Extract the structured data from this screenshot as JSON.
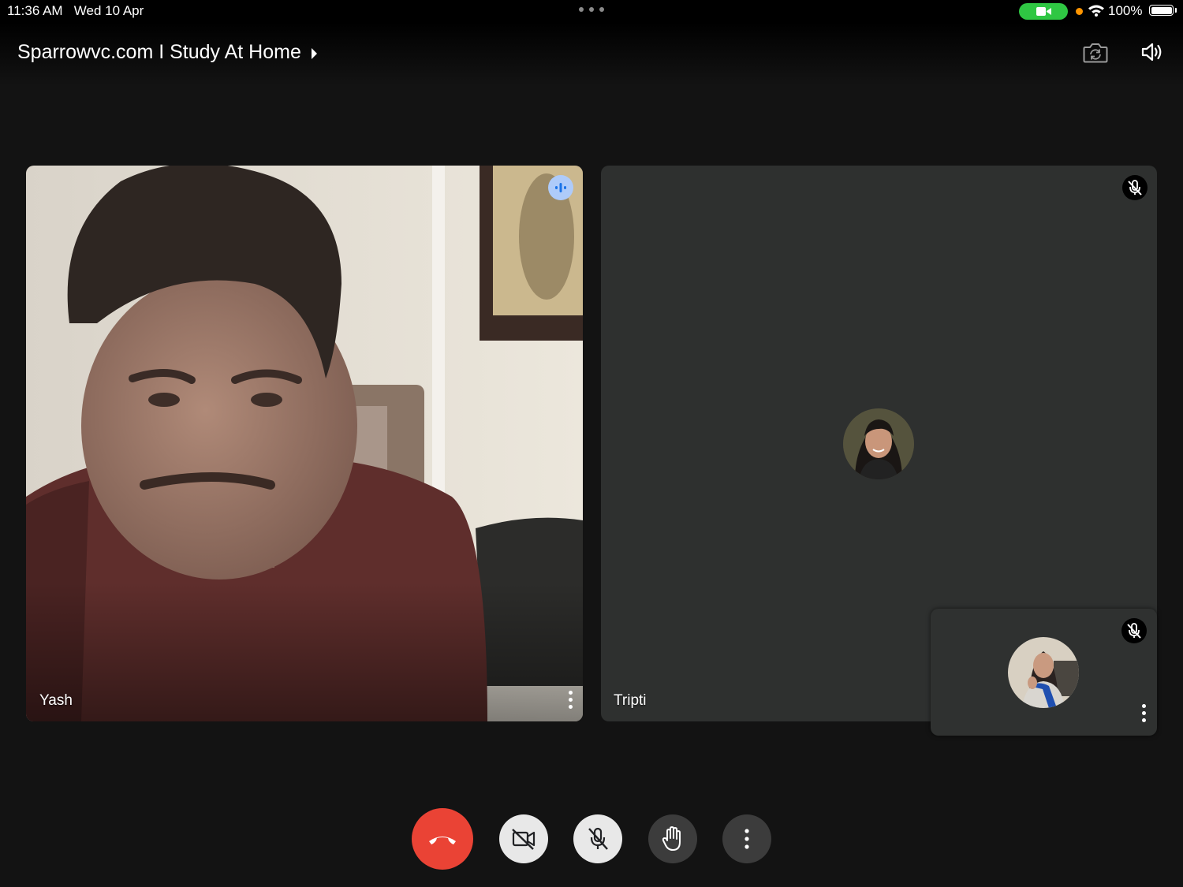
{
  "status_bar": {
    "time": "11:36 AM",
    "date": "Wed 10 Apr",
    "battery": "100%"
  },
  "meeting": {
    "title": "Sparrowvc.com I Study At Home"
  },
  "participants": [
    {
      "name": "Yash",
      "speaking": true
    },
    {
      "name": "Tripti",
      "muted": true
    }
  ],
  "self_view": {
    "muted": true
  },
  "controls": [
    "end-call",
    "camera-off",
    "mic-off",
    "raise-hand",
    "more-options"
  ],
  "colors": {
    "end_call": "#ea4335",
    "speaking_badge": "#aecbfa",
    "camera_pill": "#2fc743"
  }
}
